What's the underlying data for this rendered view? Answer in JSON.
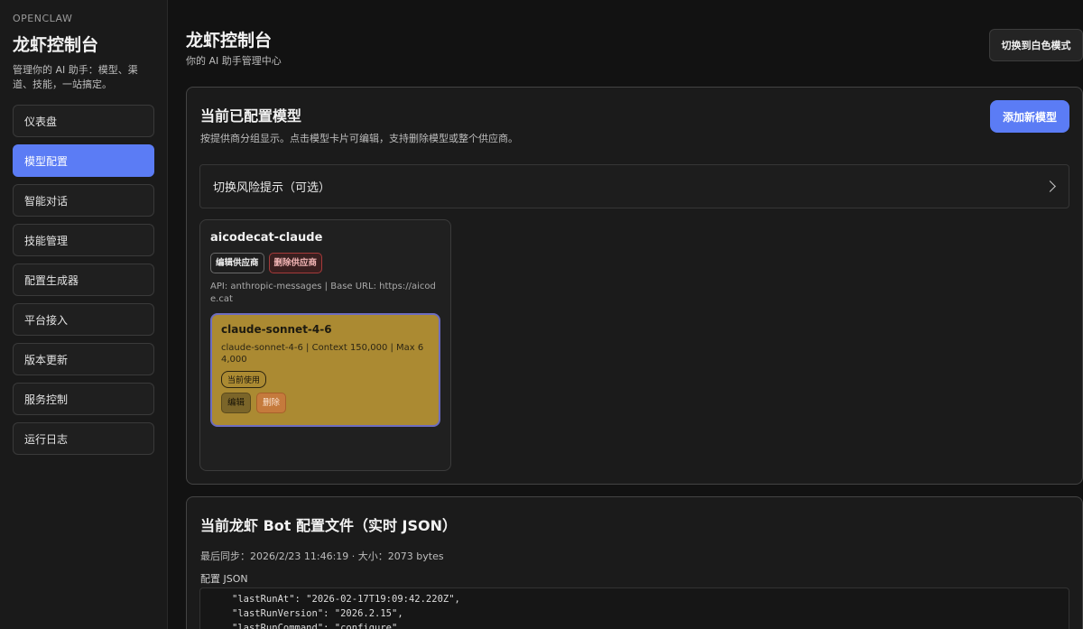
{
  "sidebar": {
    "brand": "OPENCLAW",
    "title": "龙虾控制台",
    "description": "管理你的 AI 助手：模型、渠道、技能，一站搞定。",
    "items": [
      {
        "label": "仪表盘"
      },
      {
        "label": "模型配置",
        "active": true
      },
      {
        "label": "智能对话"
      },
      {
        "label": "技能管理"
      },
      {
        "label": "配置生成器"
      },
      {
        "label": "平台接入"
      },
      {
        "label": "版本更新"
      },
      {
        "label": "服务控制"
      },
      {
        "label": "运行日志"
      }
    ]
  },
  "header": {
    "title": "龙虾控制台",
    "subtitle": "你的 AI 助手管理中心",
    "theme_button": "切换到白色模式"
  },
  "models_panel": {
    "title": "当前已配置模型",
    "description": "按提供商分组显示。点击模型卡片可编辑，支持删除模型或整个供应商。",
    "add_button": "添加新模型",
    "risk_toggle": "切换风险提示（可选）",
    "provider": {
      "name": "aicodecat-claude",
      "edit_button": "编辑供应商",
      "delete_button": "删除供应商",
      "meta": "API: anthropic-messages | Base URL: https://aicode.cat",
      "model": {
        "name": "claude-sonnet-4-6",
        "meta": "claude-sonnet-4-6 | Context 150,000 | Max 64,000",
        "badge": "当前使用",
        "edit_button": "编辑",
        "delete_button": "删除"
      }
    }
  },
  "json_panel": {
    "title": "当前龙虾 Bot 配置文件（实时 JSON）",
    "sync_info": "最后同步：2026/2/23 11:46:19 · 大小：2073 bytes",
    "label": "配置 JSON",
    "lines": [
      "\"lastRunAt\": \"2026-02-17T19:09:42.220Z\",",
      "\"lastRunVersion\": \"2026.2.15\",",
      "\"lastRunCommand\": \"configure\","
    ]
  },
  "colors": {
    "accent": "#5b7cf5",
    "model_card": "#ab8a32",
    "danger": "#a63a3a"
  }
}
